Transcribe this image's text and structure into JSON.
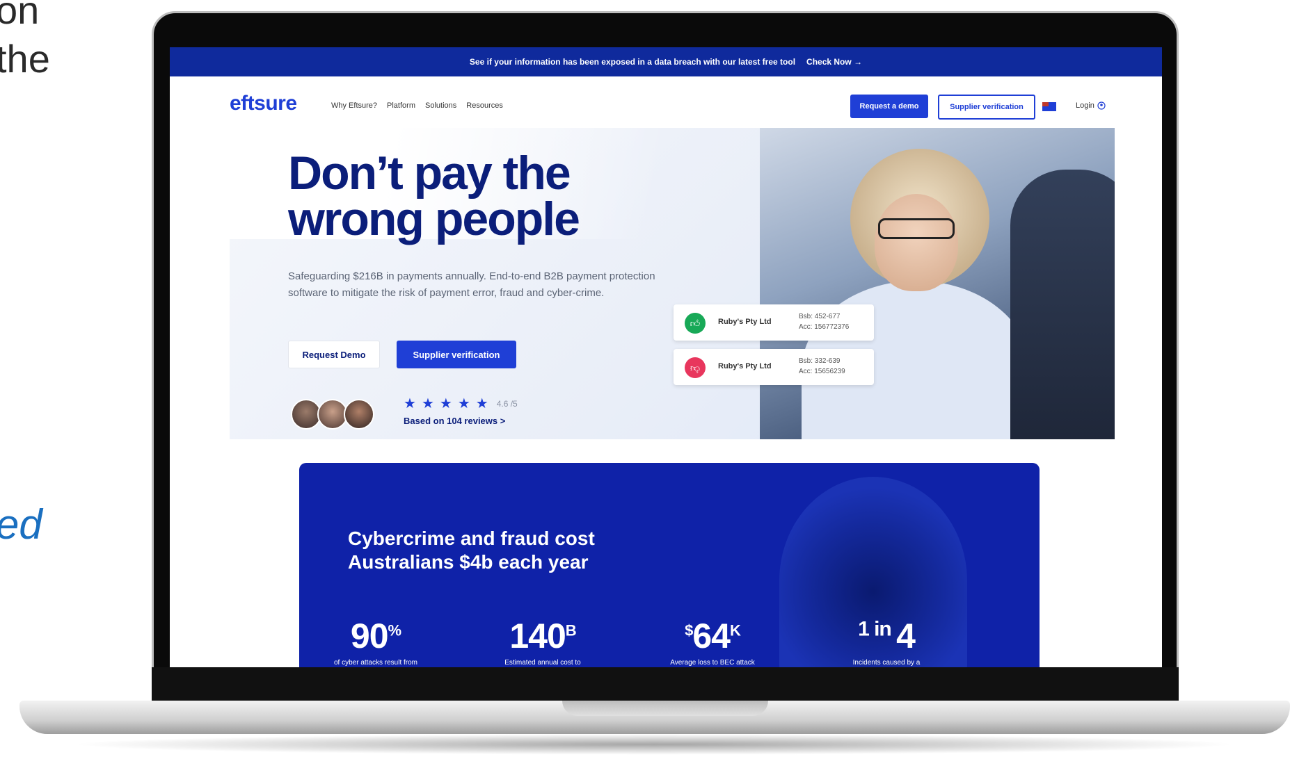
{
  "background_text": {
    "line1": "on",
    "line2": "the",
    "italic": "ed"
  },
  "banner": {
    "text": "See if your information has been exposed in a data breach with our latest free tool",
    "link": "Check Now",
    "arrow": "→"
  },
  "nav": {
    "logo": "eftsure",
    "links": [
      "Why Eftsure?",
      "Platform",
      "Solutions",
      "Resources"
    ],
    "request_demo": "Request a demo",
    "supplier_verification": "Supplier verification",
    "login": "Login"
  },
  "hero": {
    "headline_line1": "Don’t pay the",
    "headline_line2": "wrong people",
    "subtext": "Safeguarding $216B in payments annually. End-to-end B2B payment protection software to mitigate the risk of payment error, fraud and cyber-crime.",
    "request_demo": "Request Demo",
    "supplier_verification": "Supplier verification",
    "star_count": 5,
    "rating": "4.6 /5",
    "reviews": "Based on 104 reviews",
    "reviews_chevron": ">"
  },
  "cards": [
    {
      "status": "approved",
      "name": "Ruby's Pty Ltd",
      "bsb": "Bsb: 452-677",
      "acc": "Acc: 156772376",
      "color": "#18a957"
    },
    {
      "status": "rejected",
      "name": "Ruby's Pty Ltd",
      "bsb": "Bsb: 332-639",
      "acc": "Acc: 15656239",
      "color": "#e8365d"
    }
  ],
  "stats": {
    "title_line1": "Cybercrime and fraud cost",
    "title_line2": "Australians $4b each year",
    "items": [
      {
        "prefix": "",
        "value": "90",
        "suffix": "%",
        "caption": "of cyber attacks result from"
      },
      {
        "prefix": "",
        "value": "140",
        "suffix": "B",
        "caption": "Estimated annual cost to"
      },
      {
        "prefix": "$",
        "value": "64",
        "suffix": "K",
        "caption": "Average loss to BEC attack"
      },
      {
        "prefix": "1 in ",
        "value": "4",
        "suffix": "",
        "caption": "Incidents caused by a"
      }
    ]
  },
  "colors": {
    "brand_blue": "#1f3fd6",
    "navy": "#0b1e7a",
    "stats_bg": "#0f22a8"
  }
}
